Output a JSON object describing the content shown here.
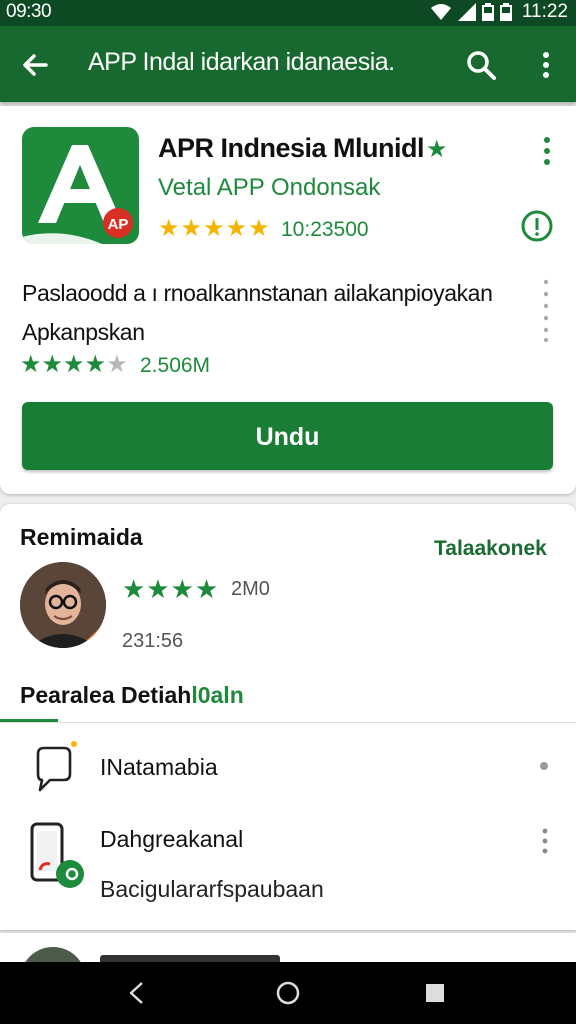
{
  "status_bar": {
    "time_left": "09:30",
    "time_right": "11:22",
    "icons": [
      "wifi-icon",
      "signal-icon",
      "battery-icon",
      "battery-icon"
    ]
  },
  "toolbar": {
    "title": "APP Indal idarkan idanaesia."
  },
  "app": {
    "name": "APR Indnesia Mlunidl",
    "developer": "Vetal APP Ondonsak",
    "stars": "★★★★★",
    "rating_count": "10:23500",
    "icon_badge": "AP",
    "description": "Paslaoodd a ı rnoalkannstanan ailakanpioyakan Apkanpskan",
    "small_stars_on": "★★★★",
    "small_stars_off": "★",
    "size": "2.506M",
    "install_label": "Undu"
  },
  "reviews": {
    "title": "Remimaida",
    "see_more": "Talaakonek",
    "stars": "★★★★",
    "count": "2M0",
    "date": "231:56"
  },
  "tabs": {
    "label_main": "Pearalea Detiah",
    "label_accent": "l0aln"
  },
  "list": {
    "item1_label": "INatamabia",
    "item2_label": "Dahgreakanal",
    "item2_sub": "Bacigulararfspaubaan"
  },
  "colors": {
    "status_bar": "#0d4a24",
    "toolbar": "#17692f",
    "accent_green": "#1e8a3c",
    "star_gold": "#f4b400",
    "button_green": "#1a7d35"
  }
}
